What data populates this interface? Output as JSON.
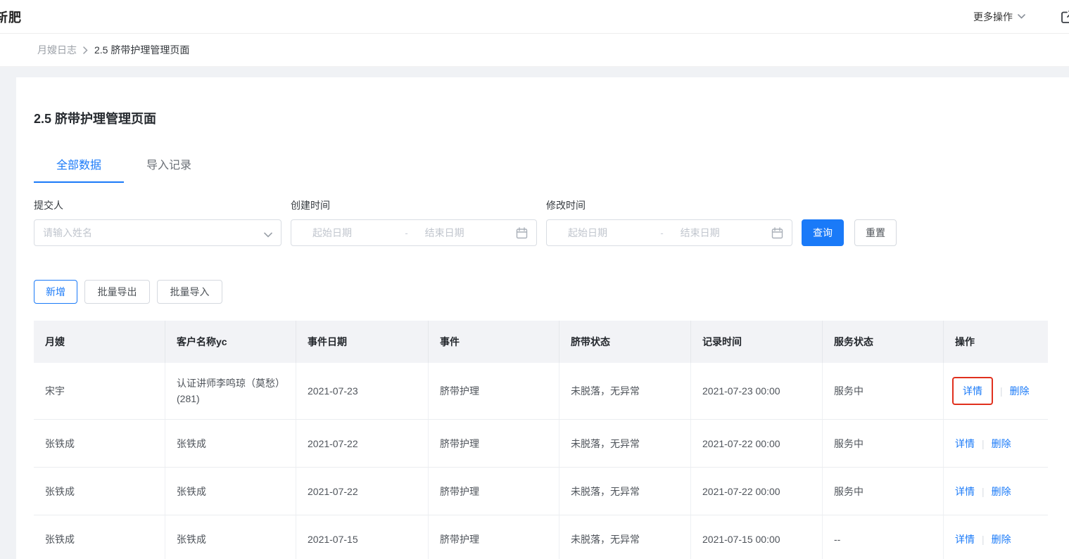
{
  "topbar": {
    "title": "斩肥",
    "more_actions_label": "更多操作"
  },
  "breadcrumb": {
    "items": [
      "月嫂日志",
      "2.5 脐带护理管理页面"
    ]
  },
  "page": {
    "title": "2.5 脐带护理管理页面",
    "tabs": [
      {
        "label": "全部数据"
      },
      {
        "label": "导入记录"
      }
    ]
  },
  "filters": {
    "submitter": {
      "label": "提交人",
      "placeholder": "请输入姓名"
    },
    "create_time": {
      "label": "创建时间",
      "start_placeholder": "起始日期",
      "end_placeholder": "结束日期",
      "separator": "-"
    },
    "modify_time": {
      "label": "修改时间",
      "start_placeholder": "起始日期",
      "end_placeholder": "结束日期",
      "separator": "-"
    },
    "search_button": "查询",
    "reset_button": "重置"
  },
  "toolbar": {
    "add_button": "新增",
    "export_button": "批量导出",
    "import_button": "批量导入"
  },
  "table": {
    "headers": [
      "月嫂",
      "客户名称yc",
      "事件日期",
      "事件",
      "脐带状态",
      "记录时间",
      "服务状态",
      "操作"
    ],
    "action_detail": "详情",
    "action_divider": "|",
    "action_delete": "删除",
    "rows": [
      {
        "yuesao": "宋宇",
        "customer": "认证讲师李鸣琼（莫愁）(281)",
        "event_date": "2021-07-23",
        "event": "脐带护理",
        "cord_status": "未脱落，无异常",
        "record_time": "2021-07-23 00:00",
        "service_status": "服务中"
      },
      {
        "yuesao": "张铁成",
        "customer": "张铁成",
        "event_date": "2021-07-22",
        "event": "脐带护理",
        "cord_status": "未脱落，无异常",
        "record_time": "2021-07-22 00:00",
        "service_status": "服务中"
      },
      {
        "yuesao": "张铁成",
        "customer": "张铁成",
        "event_date": "2021-07-22",
        "event": "脐带护理",
        "cord_status": "未脱落，无异常",
        "record_time": "2021-07-22 00:00",
        "service_status": "服务中"
      },
      {
        "yuesao": "张铁成",
        "customer": "张铁成",
        "event_date": "2021-07-15",
        "event": "脐带护理",
        "cord_status": "未脱落，无异常",
        "record_time": "2021-07-15 00:00",
        "service_status": "--"
      }
    ]
  },
  "colors": {
    "primary": "#1a7af8",
    "highlight_red": "#e0301e",
    "header_bg": "#f2f3f6"
  }
}
